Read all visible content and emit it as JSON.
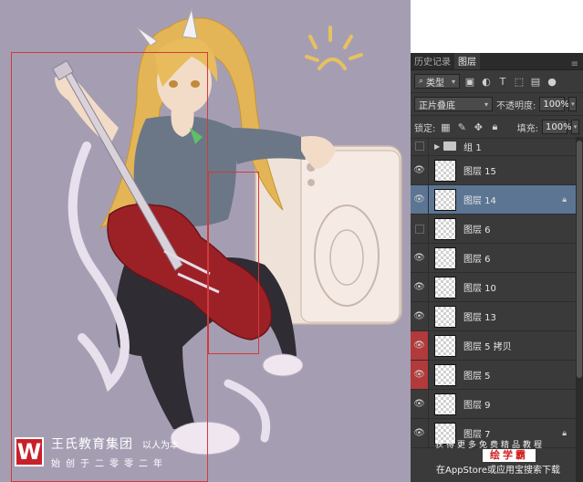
{
  "canvas": {
    "logo": {
      "badge_letter": "W",
      "name": "王氏教育集团",
      "slogan": "以人为本",
      "subtitle": "始创于二零零二年"
    }
  },
  "panel": {
    "tabs": [
      "历史记录",
      "图层"
    ],
    "active_tab": 1,
    "filter": {
      "label": "类型",
      "icon": "search-icon"
    },
    "blend_mode": "正片叠底",
    "opacity_label": "不透明度:",
    "opacity_value": "100%",
    "lock_label": "锁定:",
    "fill_label": "填充:",
    "fill_value": "100%",
    "layers": [
      {
        "name": "组 1",
        "type": "group",
        "visible": false
      },
      {
        "name": "图层 15",
        "visible": true
      },
      {
        "name": "图层 14",
        "visible": true,
        "selected": true,
        "locked": true
      },
      {
        "name": "图层 6",
        "visible": false
      },
      {
        "name": "图层 6",
        "visible": true
      },
      {
        "name": "图层 10",
        "visible": true
      },
      {
        "name": "图层 13",
        "visible": true
      },
      {
        "name": "图层 5 拷贝",
        "visible": true,
        "red": true
      },
      {
        "name": "图层 5",
        "visible": true,
        "red": true
      },
      {
        "name": "图层 9",
        "visible": true
      },
      {
        "name": "图层 7",
        "visible": true,
        "locked": true
      }
    ]
  },
  "watermark": {
    "top": "获得更多免费精品教程",
    "badge": "绘学霸",
    "bottom": "在AppStore或应用宝搜索下载"
  },
  "colors": {
    "canvas_bg": "#a59eb3",
    "selection": "#d23a3a",
    "panel_bg": "#3a3a3a",
    "selected_layer": "#5b7593",
    "red_label": "#b23a3a",
    "logo_red": "#c8202a"
  }
}
